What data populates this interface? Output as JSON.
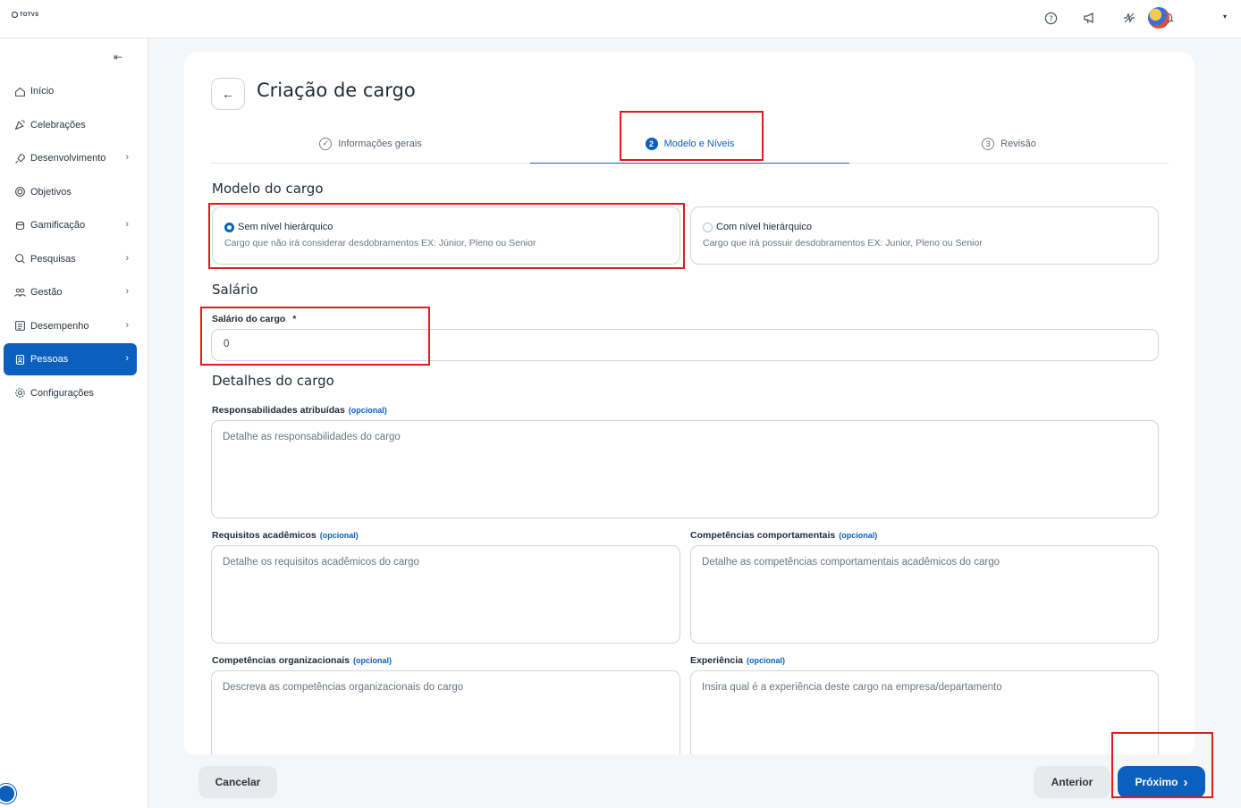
{
  "topbar": {
    "logo_text": "TOTVS",
    "icons": [
      "help-icon",
      "megaphone-icon",
      "feed-icon",
      "bell-icon"
    ],
    "caret": "▾"
  },
  "sidebar": {
    "collapse_icon": "⇤",
    "items": [
      {
        "label": "Início",
        "icon": "home-icon",
        "chevron": false
      },
      {
        "label": "Celebrações",
        "icon": "party-icon",
        "chevron": false
      },
      {
        "label": "Desenvolvimento",
        "icon": "rocket-icon",
        "chevron": true
      },
      {
        "label": "Objetivos",
        "icon": "target-icon",
        "chevron": false
      },
      {
        "label": "Gamificação",
        "icon": "coins-icon",
        "chevron": true
      },
      {
        "label": "Pesquisas",
        "icon": "search-icon",
        "chevron": true
      },
      {
        "label": "Gestão",
        "icon": "people-icon",
        "chevron": true
      },
      {
        "label": "Desempenho",
        "icon": "checklist-icon",
        "chevron": true
      },
      {
        "label": "Pessoas",
        "icon": "badge-icon",
        "chevron": true,
        "active": true
      },
      {
        "label": "Configurações",
        "icon": "gear-icon",
        "chevron": false
      }
    ]
  },
  "page": {
    "title": "Criação de cargo",
    "back_icon": "←"
  },
  "stepper": {
    "steps": [
      {
        "label": "Informações gerais",
        "marker": "✓",
        "state": "done"
      },
      {
        "label": "Modelo e Níveis",
        "marker": "2",
        "state": "active"
      },
      {
        "label": "Revisão",
        "marker": "3",
        "state": "pending"
      }
    ]
  },
  "modelo": {
    "title": "Modelo do cargo",
    "options": [
      {
        "label": "Sem nível hierárquico",
        "desc": "Cargo que não irá considerar desdobramentos EX: Júnior, Pleno ou Senior",
        "selected": true
      },
      {
        "label": "Com nível hierárquico",
        "desc": "Cargo que irá possuir desdobramentos EX: Junior, Pleno ou Senior",
        "selected": false
      }
    ]
  },
  "salario": {
    "title": "Salário",
    "label": "Salário do cargo",
    "required": "*",
    "value": "0"
  },
  "detalhes": {
    "title": "Detalhes do cargo",
    "optional": "(opcional)",
    "responsabilidades": {
      "label": "Responsabilidades atribuídas",
      "placeholder": "Detalhe as responsabilidades do cargo"
    },
    "requisitos": {
      "label": "Requisitos acadêmicos",
      "placeholder": "Detalhe os requisitos acadêmicos do cargo"
    },
    "comportamentais": {
      "label": "Competências comportamentais",
      "placeholder": "Detalhe as competências comportamentais acadêmicos do cargo"
    },
    "organizacionais": {
      "label": "Competências organizacionais",
      "placeholder": "Descreva as competências organizacionais do cargo"
    },
    "experiencia": {
      "label": "Experiência",
      "placeholder": "Insira qual é a experiência deste cargo na empresa/departamento"
    }
  },
  "footer": {
    "cancel": "Cancelar",
    "previous": "Anterior",
    "next": "Próximo",
    "next_icon": "›"
  },
  "colors": {
    "accent": "#0b5fbd",
    "highlight": "#e01b1b"
  }
}
